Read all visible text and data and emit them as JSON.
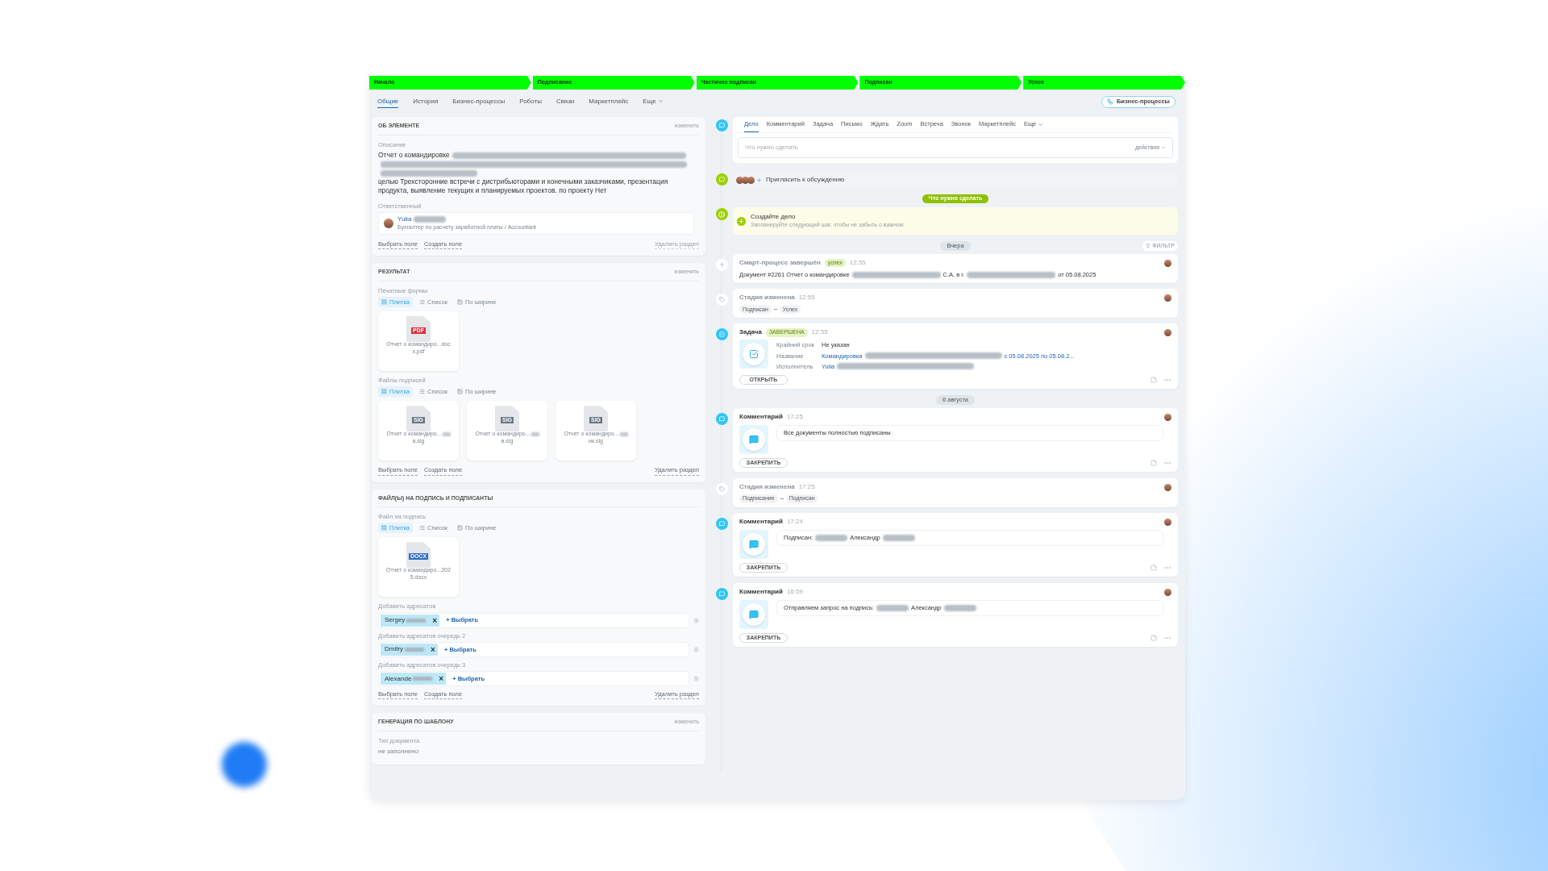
{
  "stages": [
    {
      "label": "Начало",
      "done": true
    },
    {
      "label": "Подписание",
      "done": true
    },
    {
      "label": "Частично подписан",
      "done": true
    },
    {
      "label": "Подписан",
      "done": true
    },
    {
      "label": "Успех",
      "done": true
    }
  ],
  "tabs": [
    {
      "label": "Общие",
      "selected": true,
      "has_menu": false
    },
    {
      "label": "История",
      "selected": false,
      "has_menu": false
    },
    {
      "label": "Бизнес-процессы",
      "selected": false,
      "has_menu": false
    },
    {
      "label": "Роботы",
      "selected": false,
      "has_menu": false
    },
    {
      "label": "Связи",
      "selected": false,
      "has_menu": false
    },
    {
      "label": "Маркетплейс",
      "selected": false,
      "has_menu": false
    },
    {
      "label": "Еще",
      "selected": false,
      "has_menu": true
    }
  ],
  "bp_button": "Бизнес-процессы",
  "sections": [
    {
      "title": "ОБ ЭЛЕМЕНТЕ",
      "action": "изменить",
      "blocks": [
        {
          "kind": "text_field",
          "label": "Описание",
          "parts": [
            {
              "kind": "text",
              "text": "Отчет о командировке"
            },
            {
              "kind": "redacted"
            },
            {
              "kind": "redacted"
            },
            {
              "kind": "redacted"
            },
            {
              "kind": "text",
              "text": "целью Трехсторонние встречи с дистрибьюторами и конечными заказчиками, презентация продукта, выявление текущих и планируемых проектов. по проекту Нет"
            }
          ]
        },
        {
          "kind": "person",
          "label": "Ответственный",
          "name": "Yulia",
          "position": "Бухгалтер по расчету заработной платы / Accountant"
        }
      ],
      "links": [
        {
          "label": "Выбрать поле",
          "disabled": false
        },
        {
          "label": "Создать поле",
          "disabled": false
        },
        {
          "label": "Удалить раздел",
          "disabled": true
        }
      ]
    },
    {
      "title": "РЕЗУЛЬТАТ",
      "action": "изменить",
      "blocks": [
        {
          "kind": "files",
          "label": "Печатные формы",
          "views": [
            {
              "label": "Плитка",
              "selected": true
            },
            {
              "label": "Список",
              "selected": false
            },
            {
              "label": "По ширине",
              "selected": false
            }
          ],
          "files": [
            {
              "badge": "PDF",
              "color": "#e02d3c",
              "name": "Отчет о командиро...doc",
              "tail": "x.pdf",
              "redacted": false
            }
          ]
        },
        {
          "kind": "files",
          "label": "Файлы подписей",
          "views": [
            {
              "label": "Плитка",
              "selected": true
            },
            {
              "label": "Список",
              "selected": false
            },
            {
              "label": "По ширине",
              "selected": false
            }
          ],
          "files": [
            {
              "badge": "SIG",
              "color": "#6b7682",
              "name": "Отчет о командиро...",
              "tail": "а.sig",
              "redacted": true
            },
            {
              "badge": "SIG",
              "color": "#6b7682",
              "name": "Отчет о командиро...",
              "tail": "в.sig",
              "redacted": true
            },
            {
              "badge": "SIG",
              "color": "#6b7682",
              "name": "Отчет о командиро...",
              "tail": "ик.sig",
              "redacted": true
            }
          ]
        }
      ],
      "links": [
        {
          "label": "Выбрать поле",
          "disabled": false
        },
        {
          "label": "Создать поле",
          "disabled": false
        },
        {
          "label": "Удалить раздел",
          "disabled": false
        }
      ]
    },
    {
      "title": "ФАЙЛ(Ы) НА ПОДПИСЬ И ПОДПИСАНТЫ",
      "blocks": [
        {
          "kind": "files",
          "label": "Файл на подпись",
          "views": [
            {
              "label": "Плитка",
              "selected": true
            },
            {
              "label": "Список",
              "selected": false
            },
            {
              "label": "По ширине",
              "selected": false
            }
          ],
          "files": [
            {
              "badge": "DOCX",
              "color": "#2b6cc4",
              "name": "Отчет о командиро...202",
              "tail": "5.docx",
              "redacted": false
            }
          ]
        },
        {
          "kind": "recipients",
          "label": "Добавить адресатов",
          "chip": "Sergey",
          "remove": "×",
          "add": "+ Выбрать"
        },
        {
          "kind": "recipients",
          "label": "Добавить адресатов очередь 2",
          "chip": "Dmitry",
          "remove": "×",
          "add": "+ Выбрать"
        },
        {
          "kind": "recipients",
          "label": "Добавить адресатов очередь 3",
          "chip": "Alexande",
          "remove": "×",
          "add": "+ Выбрать"
        }
      ],
      "links": [
        {
          "label": "Выбрать поле",
          "disabled": false
        },
        {
          "label": "Создать поле",
          "disabled": false
        },
        {
          "label": "Удалить раздел",
          "disabled": false
        }
      ]
    },
    {
      "title": "ГЕНЕРАЦИЯ ПО ШАБЛОНУ",
      "action": "изменить",
      "blocks": [
        {
          "kind": "plain_field",
          "label": "Тип документа",
          "value": "не заполнено"
        }
      ]
    }
  ],
  "composer": {
    "tabs": [
      {
        "label": "Дело",
        "selected": true,
        "has_menu": false
      },
      {
        "label": "Комментарий",
        "selected": false,
        "has_menu": false
      },
      {
        "label": "Задача",
        "selected": false,
        "has_menu": false
      },
      {
        "label": "Письмо",
        "selected": false,
        "has_menu": false
      },
      {
        "label": "Ждать",
        "selected": false,
        "has_menu": false
      },
      {
        "label": "Zoom",
        "selected": false,
        "has_menu": false
      },
      {
        "label": "Встреча",
        "selected": false,
        "has_menu": false
      },
      {
        "label": "Звонок",
        "selected": false,
        "has_menu": false
      },
      {
        "label": "Маркетплейс",
        "selected": false,
        "has_menu": false
      },
      {
        "label": "Еще",
        "selected": false,
        "has_menu": true
      }
    ],
    "placeholder": "Что нужно сделать",
    "actions": "действия"
  },
  "invite": "Пригласить к обсуждению",
  "todo_pill": "Что нужно сделать",
  "todo": {
    "title": "Создайте дело",
    "hint": "Запланируйте следующий шаг, чтобы не забыть о важном"
  },
  "filter": "ФИЛЬТР",
  "timeline": [
    {
      "kind": "date",
      "label": "Вчера"
    },
    {
      "kind": "smart_process",
      "title": "Смарт-процесс завершён",
      "badge": "успех",
      "time": "12:55",
      "parts": [
        {
          "kind": "text",
          "text": "Документ #2261 Отчет о командировке"
        },
        {
          "kind": "redacted"
        },
        {
          "kind": "text",
          "text": "С.А. в г."
        },
        {
          "kind": "redacted"
        },
        {
          "kind": "text",
          "text": "от 05.08.2025"
        }
      ]
    },
    {
      "kind": "stage",
      "title": "Стадия изменена",
      "time": "12:55",
      "from": "Подписан",
      "to": "Успех"
    },
    {
      "kind": "task",
      "title": "Задача",
      "badge": "ЗАВЕРШЕНА",
      "time": "12:55",
      "rows": [
        {
          "label": "Крайний срок",
          "kind": "plain",
          "parts": [
            {
              "kind": "text",
              "text": "Не указан"
            }
          ]
        },
        {
          "label": "Название",
          "kind": "link",
          "parts": [
            {
              "kind": "text",
              "text": "Командировка"
            },
            {
              "kind": "redacted"
            },
            {
              "kind": "text",
              "text": "с 05.08.2025 по 05.08.2..."
            }
          ]
        },
        {
          "label": "Исполнитель",
          "kind": "link",
          "parts": [
            {
              "kind": "text",
              "text": "Yulia"
            },
            {
              "kind": "redacted"
            }
          ]
        }
      ],
      "button": "ОТКРЫТЬ"
    },
    {
      "kind": "date",
      "label": "6 августа"
    },
    {
      "kind": "comment",
      "title": "Комментарий",
      "time": "17:25",
      "parts": [
        {
          "kind": "text",
          "text": "Все документы полностью подписаны"
        }
      ],
      "button": "ЗАКРЕПИТЬ"
    },
    {
      "kind": "stage",
      "title": "Стадия изменена",
      "time": "17:25",
      "from": "Подписание",
      "to": "Подписан"
    },
    {
      "kind": "comment",
      "title": "Комментарий",
      "time": "17:24",
      "parts": [
        {
          "kind": "text",
          "text": "Подписан:"
        },
        {
          "kind": "redacted"
        },
        {
          "kind": "text",
          "text": "Александр"
        },
        {
          "kind": "redacted"
        }
      ],
      "button": "ЗАКРЕПИТЬ"
    },
    {
      "kind": "comment",
      "title": "Комментарий",
      "time": "16:59",
      "parts": [
        {
          "kind": "text",
          "text": "Отправляем запрос на подпись:"
        },
        {
          "kind": "redacted"
        },
        {
          "kind": "text",
          "text": "Александр"
        },
        {
          "kind": "redacted"
        }
      ],
      "button": "ЗАКРЕПИТЬ"
    }
  ]
}
